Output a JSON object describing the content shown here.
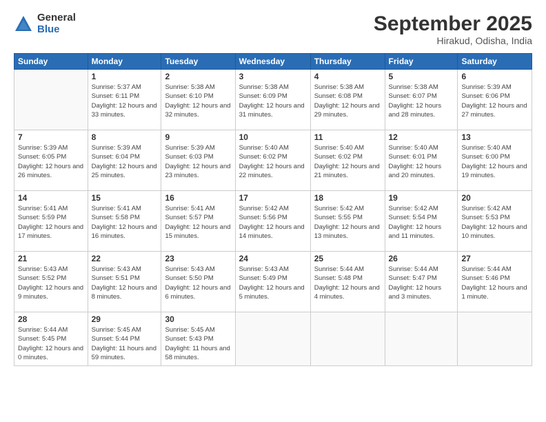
{
  "logo": {
    "general": "General",
    "blue": "Blue"
  },
  "header": {
    "month": "September 2025",
    "location": "Hirakud, Odisha, India"
  },
  "weekdays": [
    "Sunday",
    "Monday",
    "Tuesday",
    "Wednesday",
    "Thursday",
    "Friday",
    "Saturday"
  ],
  "weeks": [
    [
      {
        "day": "",
        "info": ""
      },
      {
        "day": "1",
        "info": "Sunrise: 5:37 AM\nSunset: 6:11 PM\nDaylight: 12 hours\nand 33 minutes."
      },
      {
        "day": "2",
        "info": "Sunrise: 5:38 AM\nSunset: 6:10 PM\nDaylight: 12 hours\nand 32 minutes."
      },
      {
        "day": "3",
        "info": "Sunrise: 5:38 AM\nSunset: 6:09 PM\nDaylight: 12 hours\nand 31 minutes."
      },
      {
        "day": "4",
        "info": "Sunrise: 5:38 AM\nSunset: 6:08 PM\nDaylight: 12 hours\nand 29 minutes."
      },
      {
        "day": "5",
        "info": "Sunrise: 5:38 AM\nSunset: 6:07 PM\nDaylight: 12 hours\nand 28 minutes."
      },
      {
        "day": "6",
        "info": "Sunrise: 5:39 AM\nSunset: 6:06 PM\nDaylight: 12 hours\nand 27 minutes."
      }
    ],
    [
      {
        "day": "7",
        "info": "Sunrise: 5:39 AM\nSunset: 6:05 PM\nDaylight: 12 hours\nand 26 minutes."
      },
      {
        "day": "8",
        "info": "Sunrise: 5:39 AM\nSunset: 6:04 PM\nDaylight: 12 hours\nand 25 minutes."
      },
      {
        "day": "9",
        "info": "Sunrise: 5:39 AM\nSunset: 6:03 PM\nDaylight: 12 hours\nand 23 minutes."
      },
      {
        "day": "10",
        "info": "Sunrise: 5:40 AM\nSunset: 6:02 PM\nDaylight: 12 hours\nand 22 minutes."
      },
      {
        "day": "11",
        "info": "Sunrise: 5:40 AM\nSunset: 6:02 PM\nDaylight: 12 hours\nand 21 minutes."
      },
      {
        "day": "12",
        "info": "Sunrise: 5:40 AM\nSunset: 6:01 PM\nDaylight: 12 hours\nand 20 minutes."
      },
      {
        "day": "13",
        "info": "Sunrise: 5:40 AM\nSunset: 6:00 PM\nDaylight: 12 hours\nand 19 minutes."
      }
    ],
    [
      {
        "day": "14",
        "info": "Sunrise: 5:41 AM\nSunset: 5:59 PM\nDaylight: 12 hours\nand 17 minutes."
      },
      {
        "day": "15",
        "info": "Sunrise: 5:41 AM\nSunset: 5:58 PM\nDaylight: 12 hours\nand 16 minutes."
      },
      {
        "day": "16",
        "info": "Sunrise: 5:41 AM\nSunset: 5:57 PM\nDaylight: 12 hours\nand 15 minutes."
      },
      {
        "day": "17",
        "info": "Sunrise: 5:42 AM\nSunset: 5:56 PM\nDaylight: 12 hours\nand 14 minutes."
      },
      {
        "day": "18",
        "info": "Sunrise: 5:42 AM\nSunset: 5:55 PM\nDaylight: 12 hours\nand 13 minutes."
      },
      {
        "day": "19",
        "info": "Sunrise: 5:42 AM\nSunset: 5:54 PM\nDaylight: 12 hours\nand 11 minutes."
      },
      {
        "day": "20",
        "info": "Sunrise: 5:42 AM\nSunset: 5:53 PM\nDaylight: 12 hours\nand 10 minutes."
      }
    ],
    [
      {
        "day": "21",
        "info": "Sunrise: 5:43 AM\nSunset: 5:52 PM\nDaylight: 12 hours\nand 9 minutes."
      },
      {
        "day": "22",
        "info": "Sunrise: 5:43 AM\nSunset: 5:51 PM\nDaylight: 12 hours\nand 8 minutes."
      },
      {
        "day": "23",
        "info": "Sunrise: 5:43 AM\nSunset: 5:50 PM\nDaylight: 12 hours\nand 6 minutes."
      },
      {
        "day": "24",
        "info": "Sunrise: 5:43 AM\nSunset: 5:49 PM\nDaylight: 12 hours\nand 5 minutes."
      },
      {
        "day": "25",
        "info": "Sunrise: 5:44 AM\nSunset: 5:48 PM\nDaylight: 12 hours\nand 4 minutes."
      },
      {
        "day": "26",
        "info": "Sunrise: 5:44 AM\nSunset: 5:47 PM\nDaylight: 12 hours\nand 3 minutes."
      },
      {
        "day": "27",
        "info": "Sunrise: 5:44 AM\nSunset: 5:46 PM\nDaylight: 12 hours\nand 1 minute."
      }
    ],
    [
      {
        "day": "28",
        "info": "Sunrise: 5:44 AM\nSunset: 5:45 PM\nDaylight: 12 hours\nand 0 minutes."
      },
      {
        "day": "29",
        "info": "Sunrise: 5:45 AM\nSunset: 5:44 PM\nDaylight: 11 hours\nand 59 minutes."
      },
      {
        "day": "30",
        "info": "Sunrise: 5:45 AM\nSunset: 5:43 PM\nDaylight: 11 hours\nand 58 minutes."
      },
      {
        "day": "",
        "info": ""
      },
      {
        "day": "",
        "info": ""
      },
      {
        "day": "",
        "info": ""
      },
      {
        "day": "",
        "info": ""
      }
    ]
  ]
}
